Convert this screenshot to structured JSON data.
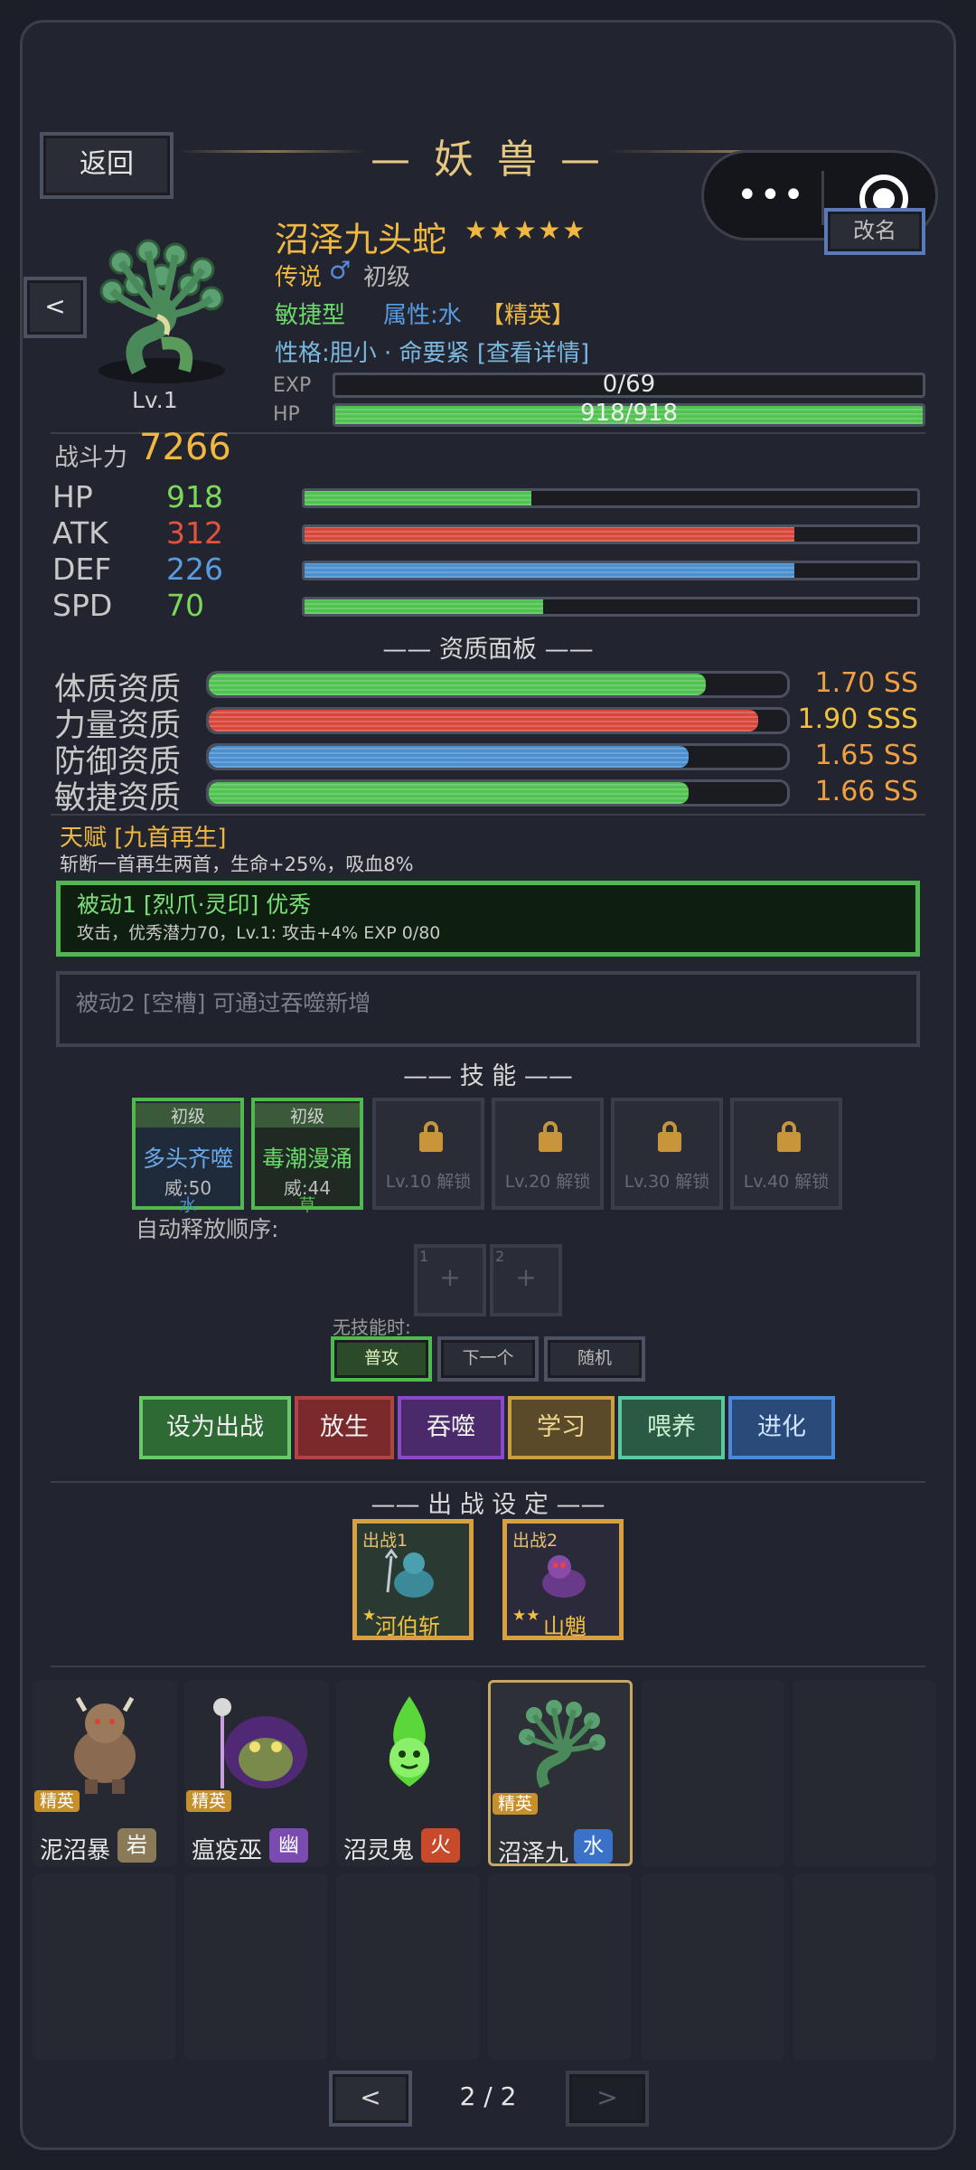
{
  "header": {
    "back_label": "返回",
    "title": "— 妖 兽 —",
    "rename_label": "改名",
    "prev_label": "<"
  },
  "pet": {
    "name": "沼泽九头蛇",
    "stars": "★★★★★",
    "rarity": "传说",
    "gender": "♂",
    "stage": "初级",
    "type": "敏捷型",
    "attribute": "属性:水",
    "elite": "【精英】",
    "personality": "性格:胆小 · 命要紧 [查看详情]",
    "level": "Lv.1",
    "exp_label": "EXP",
    "exp_text": "0/69",
    "exp_progress": 0,
    "hp_label": "HP",
    "hp_text": "918/918",
    "hp_progress": 1.0
  },
  "power": {
    "label": "战斗力",
    "value": "7266"
  },
  "stats": [
    {
      "label": "HP",
      "value": "918",
      "color": "#7bd85a",
      "bar_color": "#4fc24f",
      "fill": 0.37
    },
    {
      "label": "ATK",
      "value": "312",
      "color": "#e2533d",
      "bar_color": "#d8483a",
      "fill": 0.8
    },
    {
      "label": "DEF",
      "value": "226",
      "color": "#5a9be0",
      "bar_color": "#4a8fd0",
      "fill": 0.8
    },
    {
      "label": "SPD",
      "value": "70",
      "color": "#7bd85a",
      "bar_color": "#4fc24f",
      "fill": 0.39
    }
  ],
  "aptitude": {
    "title": "—— 资质面板 ——",
    "items": [
      {
        "label": "体质资质",
        "value": "1.70 SS",
        "bar_color": "#4fc24f",
        "fill": 0.86,
        "color": "#f0a040"
      },
      {
        "label": "力量资质",
        "value": "1.90 SSS",
        "bar_color": "#d8483a",
        "fill": 0.95,
        "color": "#f0c040"
      },
      {
        "label": "防御资质",
        "value": "1.65 SS",
        "bar_color": "#4a8fd0",
        "fill": 0.83,
        "color": "#f0a040"
      },
      {
        "label": "敏捷资质",
        "value": "1.66 SS",
        "bar_color": "#4fc24f",
        "fill": 0.83,
        "color": "#f0a040"
      }
    ]
  },
  "talent": {
    "title": "天赋 [九首再生]",
    "desc": "斩断一首再生两首，生命+25%，吸血8%"
  },
  "passive1": {
    "title": "被动1 [烈爪·灵印] 优秀",
    "desc": "攻击，优秀潜力70，Lv.1: 攻击+4%  EXP 0/80"
  },
  "passive2": {
    "title": "被动2 [空槽] 可通过吞噬新增"
  },
  "skills": {
    "title": "—— 技 能 ——",
    "learned": [
      {
        "level": "初级",
        "name": "多头齐噬",
        "power": "威:50",
        "element": "水"
      },
      {
        "level": "初级",
        "name": "毒潮漫涌",
        "power": "威:44",
        "element": "草"
      }
    ],
    "locked": [
      "Lv.10 解锁",
      "Lv.20 解锁",
      "Lv.30 解锁",
      "Lv.40 解锁"
    ],
    "auto_order_label": "自动释放顺序:",
    "order_slots": [
      {
        "num": "1",
        "sym": "+"
      },
      {
        "num": "2",
        "sym": "+"
      }
    ],
    "no_skill_label": "无技能时:",
    "no_skill_options": [
      "普攻",
      "下一个",
      "随机"
    ]
  },
  "actions": [
    "设为出战",
    "放生",
    "吞噬",
    "学习",
    "喂养",
    "进化"
  ],
  "battle": {
    "title": "—— 出 战 设 定 ——",
    "slots": [
      {
        "label": "出战1",
        "stars": "★",
        "name": "河伯斩"
      },
      {
        "label": "出战2",
        "stars": "★★",
        "name": "山魈"
      }
    ]
  },
  "pets": [
    {
      "name": "泥沼暴",
      "element": "岩",
      "elem_color": "#8a7a58",
      "tag": "精英"
    },
    {
      "name": "瘟疫巫",
      "element": "幽",
      "elem_color": "#7a4bb0",
      "tag": "精英"
    },
    {
      "name": "沼灵鬼",
      "element": "火",
      "elem_color": "#c84a2a",
      "tag": ""
    },
    {
      "name": "沼泽九",
      "element": "水",
      "elem_color": "#3a72c8",
      "tag": "精英"
    }
  ],
  "pagination": {
    "prev": "<",
    "next": ">",
    "text": "2 / 2"
  }
}
